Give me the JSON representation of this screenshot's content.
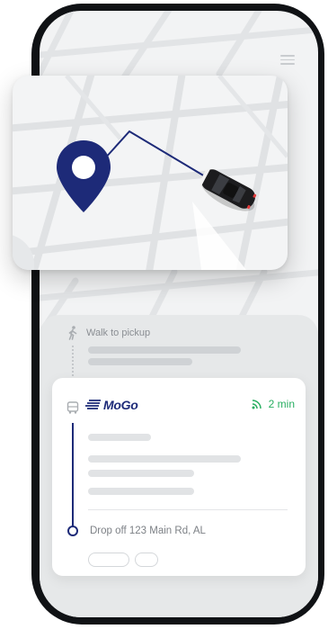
{
  "map": {
    "pin_color": "#1d2a78",
    "route_color": "#1d2a78",
    "car_color": "#1c1c1e",
    "pin_icon": "location-pin-icon",
    "car_icon": "car-icon"
  },
  "header": {
    "menu_icon": "menu-icon"
  },
  "walk": {
    "label": "Walk to pickup",
    "icon": "walking-person-icon"
  },
  "ride": {
    "brand": "MoGo",
    "brand_color": "#1d2a78",
    "eta": "2 min",
    "eta_color": "#27ae60",
    "eta_icon": "live-signal-icon",
    "vehicle_icon": "bus-icon",
    "dropoff": "Drop off 123 Main Rd, AL"
  }
}
